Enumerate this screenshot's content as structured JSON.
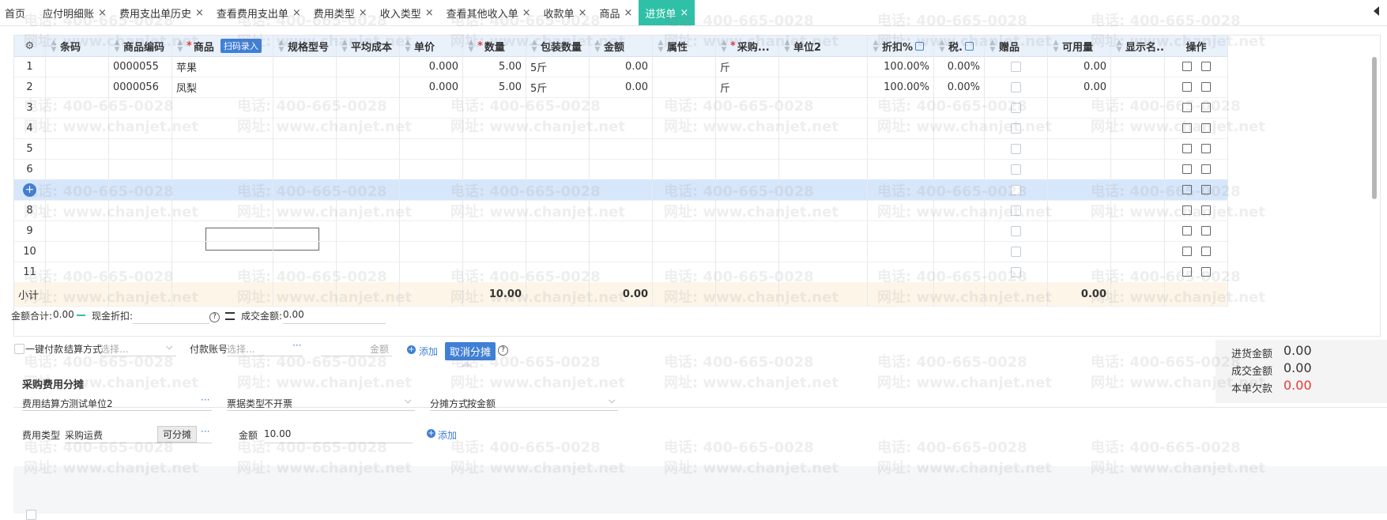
{
  "tabs": [
    {
      "label": "首页",
      "closable": false
    },
    {
      "label": "应付明细账",
      "closable": true
    },
    {
      "label": "费用支出单历史",
      "closable": true
    },
    {
      "label": "查看费用支出单",
      "closable": true
    },
    {
      "label": "费用类型",
      "closable": true
    },
    {
      "label": "收入类型",
      "closable": true
    },
    {
      "label": "查看其他收入单",
      "closable": true
    },
    {
      "label": "收款单",
      "closable": true
    },
    {
      "label": "商品",
      "closable": true
    },
    {
      "label": "进货单",
      "closable": true,
      "active": true
    }
  ],
  "close_glyph": "×",
  "columns": [
    {
      "key": "no",
      "label": ""
    },
    {
      "key": "barcode",
      "label": "条码"
    },
    {
      "key": "code",
      "label": "商品编码"
    },
    {
      "key": "name",
      "label": "商品",
      "required": true
    },
    {
      "key": "spec",
      "label": "规格型号"
    },
    {
      "key": "avgcost",
      "label": "平均成本"
    },
    {
      "key": "price",
      "label": "单价"
    },
    {
      "key": "qty",
      "label": "数量",
      "required": true
    },
    {
      "key": "pack",
      "label": "包装数量"
    },
    {
      "key": "amount",
      "label": "金额"
    },
    {
      "key": "attr",
      "label": "属性"
    },
    {
      "key": "unit",
      "label": "采购...",
      "required": true
    },
    {
      "key": "unit2",
      "label": "单位2"
    },
    {
      "key": "discount",
      "label": "折扣%"
    },
    {
      "key": "tax",
      "label": "税."
    },
    {
      "key": "gift",
      "label": "赠品"
    },
    {
      "key": "avail",
      "label": "可用量"
    },
    {
      "key": "display",
      "label": "显示名..."
    },
    {
      "key": "ops",
      "label": "操作"
    }
  ],
  "scan_label": "扫码录入",
  "rows": [
    {
      "no": "1",
      "code": "0000055",
      "name": "苹果",
      "price": "0.000",
      "qty": "5.00",
      "pack": "5斤",
      "amount": "0.00",
      "unit": "斤",
      "discount": "100.00%",
      "tax": "0.00%",
      "avail": "0.00"
    },
    {
      "no": "2",
      "code": "0000056",
      "name": "凤梨",
      "price": "0.000",
      "qty": "5.00",
      "pack": "5斤",
      "amount": "0.00",
      "unit": "斤",
      "discount": "100.00%",
      "tax": "0.00%",
      "avail": "0.00"
    },
    {
      "no": "3"
    },
    {
      "no": "4"
    },
    {
      "no": "5"
    },
    {
      "no": "6"
    },
    {
      "no": ""
    },
    {
      "no": "8"
    },
    {
      "no": "9"
    },
    {
      "no": "10"
    },
    {
      "no": "11"
    }
  ],
  "subtotal": {
    "label": "小计",
    "qty": "10.00",
    "amount": "0.00",
    "avail": "0.00"
  },
  "summary": {
    "amount_total_label": "金额合计:",
    "amount_total": "0.00",
    "cash_discount_label": "现金折扣:",
    "deal_amount_label": "成交金额:",
    "deal_amount": "0.00"
  },
  "payment": {
    "one_click_label": "一键付款",
    "settle_label": "结算方式",
    "settle_placeholder": "选择...",
    "account_label": "付款账号",
    "account_placeholder": "选择...",
    "amount_placeholder": "金额",
    "add_label": "添加",
    "cancel_alloc_label": "取消分摊"
  },
  "totals": [
    {
      "label": "进货金额",
      "value": "0.00",
      "color": "#333333"
    },
    {
      "label": "成交金额",
      "value": "0.00",
      "color": "#333333"
    },
    {
      "label": "本单欠款",
      "value": "0.00",
      "color": "#e53935"
    }
  ],
  "fee_panel": {
    "title": "采购费用分摊",
    "settle_party_label": "费用结算方",
    "settle_party_value": "测试单位2",
    "invoice_type_label": "票据类型",
    "invoice_type_value": "不开票",
    "alloc_method_label": "分摊方式",
    "alloc_method_value": "按金额",
    "fee_type_label": "费用类型",
    "fee_type_value": "采购运费",
    "allocable_label": "可分摊",
    "amount_label": "金额",
    "amount_value": "10.00",
    "add_label": "添加"
  },
  "watermark": {
    "phone": "电话: 400-665-0028",
    "web": "网址: www.chanjet.net"
  },
  "colors": {
    "accent": "#2ec1a8",
    "primary": "#3f7fd6",
    "danger": "#e53935",
    "header_bg": "#e9f1fb",
    "selected_row": "#d7e7fb"
  }
}
